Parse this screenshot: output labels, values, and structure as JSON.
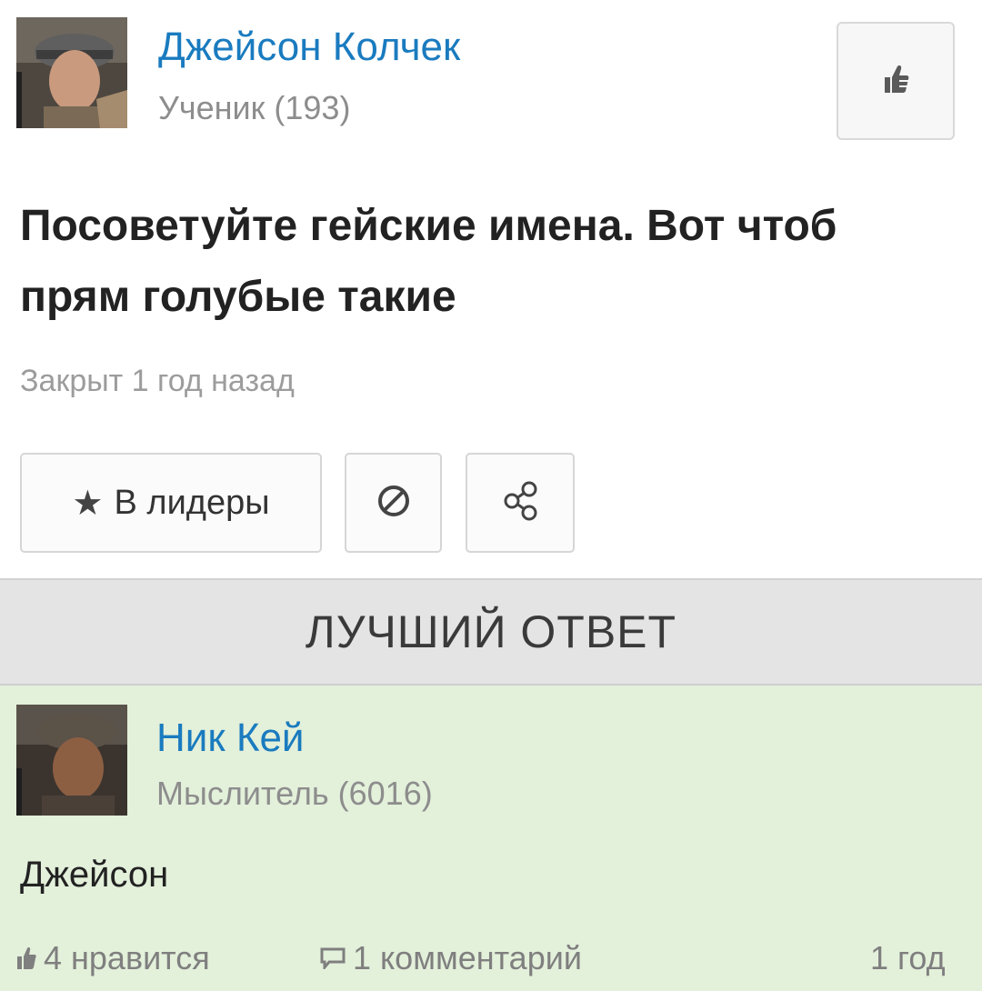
{
  "question": {
    "author": {
      "name": "Джейсон Колчек",
      "rank": "Ученик (193)",
      "avatar_icon": "user-photo"
    },
    "title": "Посоветуйте гейские имена. Вот чтоб прям голубые такие",
    "status": "Закрыт 1 год назад",
    "actions": {
      "leaders_label": "В лидеры",
      "leaders_icon": "star-icon",
      "block_icon": "block-icon",
      "share_icon": "share-icon",
      "like_icon": "thumbs-up-icon"
    }
  },
  "best_answer": {
    "header": "ЛУЧШИЙ ОТВЕТ",
    "author": {
      "name": "Ник Кей",
      "rank": "Мыслитель (6016)",
      "avatar_icon": "user-photo"
    },
    "text": "Джейсон",
    "footer": {
      "likes": "4 нравится",
      "comments": "1 комментарий",
      "time": "1 год"
    }
  },
  "colors": {
    "link": "#1a7bbf",
    "answer_bg": "#e3f0da",
    "header_bg": "#e4e4e4"
  }
}
